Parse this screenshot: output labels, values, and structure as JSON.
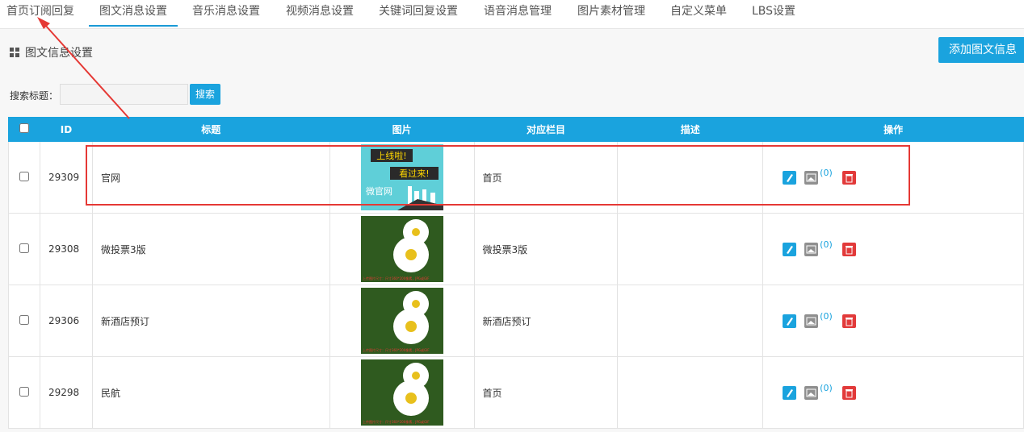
{
  "tabs": [
    "首页订阅回复",
    "图文消息设置",
    "音乐消息设置",
    "视频消息设置",
    "关键词回复设置",
    "语音消息管理",
    "图片素材管理",
    "自定义菜单",
    "LBS设置"
  ],
  "section_title": "图文信息设置",
  "add_button": "添加图文信息",
  "search": {
    "label": "搜索标题：",
    "button": "搜索",
    "value": ""
  },
  "table": {
    "headers": [
      "ID",
      "标题",
      "图片",
      "对应栏目",
      "描述",
      "操作"
    ],
    "rows": [
      {
        "id": "29309",
        "title": "官网",
        "column": "首页",
        "desc": "",
        "count": "(0)",
        "thumb_line1": "上线啦!",
        "thumb_line2": "看过来!",
        "thumb_line3": "微官网"
      },
      {
        "id": "29308",
        "title": "微投票3版",
        "column": "微投票3版",
        "desc": "",
        "count": "(0)",
        "caption": "上传图片尺寸：尺寸360*200像素，JPG或GIF"
      },
      {
        "id": "29306",
        "title": "新酒店预订",
        "column": "新酒店预订",
        "desc": "",
        "count": "(0)",
        "caption": "上传图片尺寸：尺寸360*200像素，JPG或GIF"
      },
      {
        "id": "29298",
        "title": "民航",
        "column": "首页",
        "desc": "",
        "count": "(0)",
        "caption": "上传图片尺寸：尺寸360*200像素，JPG或GIF"
      }
    ]
  },
  "colors": {
    "accent": "#1aa3de",
    "highlight": "#e53935"
  }
}
